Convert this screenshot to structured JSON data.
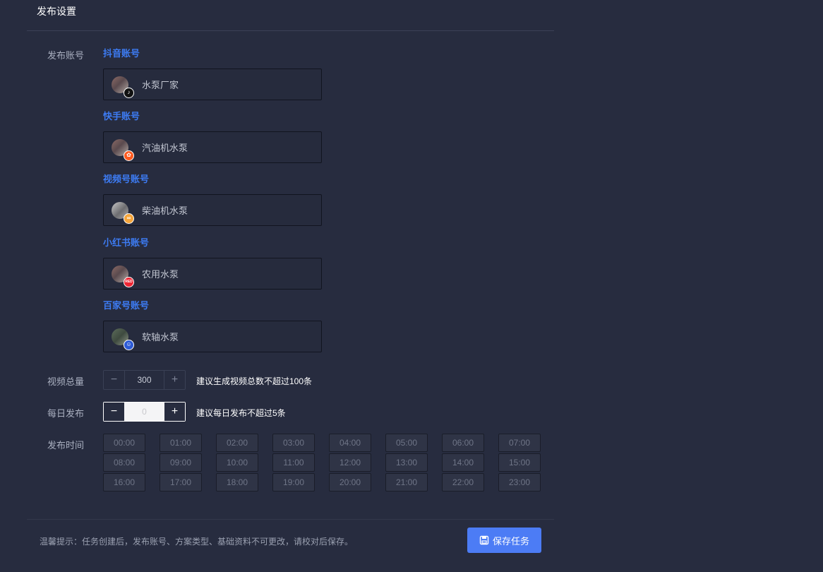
{
  "header": {
    "title": "发布设置"
  },
  "accounts_section": {
    "label": "发布账号",
    "platforms": [
      {
        "title": "抖音账号",
        "account_name": "水泵厂家",
        "badge_icon": "douyin-icon",
        "badge_text": "♪"
      },
      {
        "title": "快手账号",
        "account_name": "汽油机水泵",
        "badge_icon": "kuaishou-icon",
        "badge_text": "✿"
      },
      {
        "title": "视频号账号",
        "account_name": "柴油机水泵",
        "badge_icon": "shipinhao-icon",
        "badge_text": "∞"
      },
      {
        "title": "小红书账号",
        "account_name": "农用水泵",
        "badge_icon": "xiaohongshu-icon",
        "badge_text": "RED"
      },
      {
        "title": "百家号账号",
        "account_name": "软轴水泵",
        "badge_icon": "baijiahao-icon",
        "badge_text": "☺"
      }
    ]
  },
  "video_total": {
    "label": "视频总量",
    "value": "300",
    "minus_symbol": "−",
    "plus_symbol": "+",
    "hint": "建议生成视频总数不超过100条"
  },
  "daily_publish": {
    "label": "每日发布",
    "value": "0",
    "minus_symbol": "−",
    "plus_symbol": "+",
    "hint": "建议每日发布不超过5条"
  },
  "publish_time": {
    "label": "发布时间",
    "slots": [
      "00:00",
      "01:00",
      "02:00",
      "03:00",
      "04:00",
      "05:00",
      "06:00",
      "07:00",
      "08:00",
      "09:00",
      "10:00",
      "11:00",
      "12:00",
      "13:00",
      "14:00",
      "15:00",
      "16:00",
      "17:00",
      "18:00",
      "19:00",
      "20:00",
      "21:00",
      "22:00",
      "23:00"
    ]
  },
  "footer": {
    "tip": "温馨提示：任务创建后，发布账号、方案类型、基础资料不可更改，请校对后保存。",
    "save_label": "保存任务"
  },
  "colors": {
    "background": "#272c3f",
    "platform_title": "#3d7bf2",
    "primary_button": "#4c7cf5"
  }
}
